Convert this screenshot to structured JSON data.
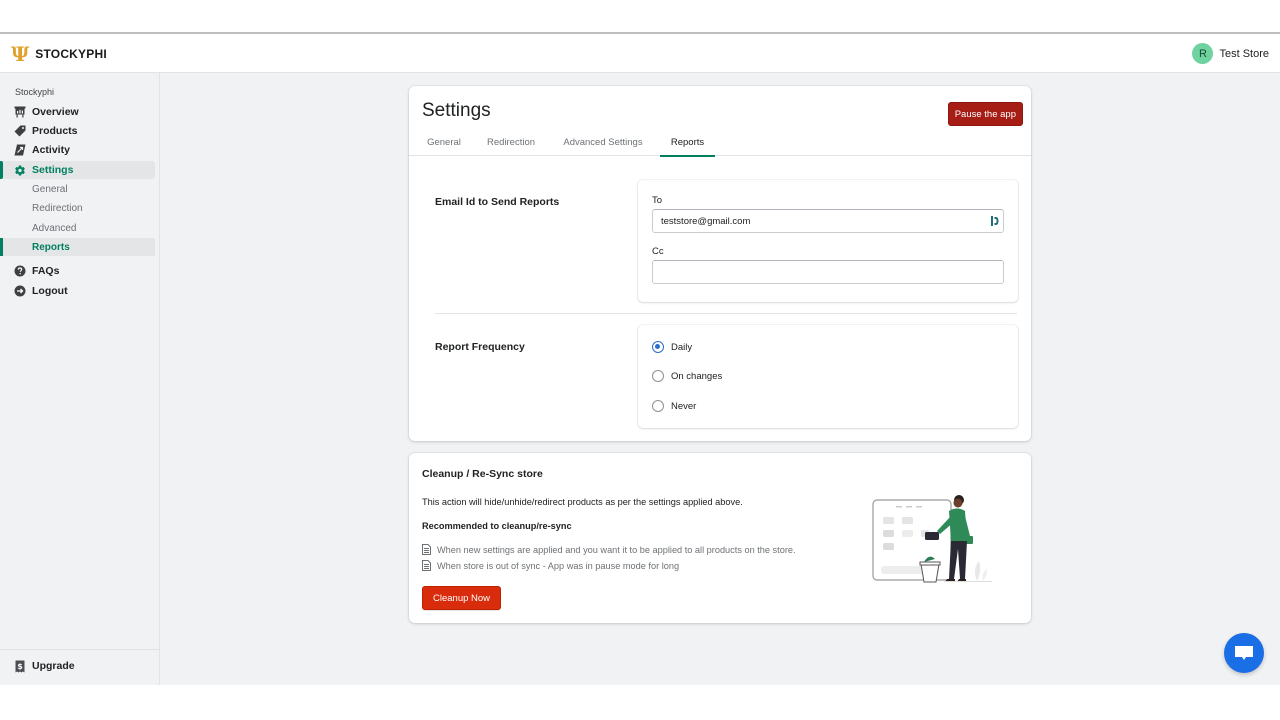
{
  "app": {
    "brand": "STOCKYPHI",
    "brand_mark": "Ψ",
    "accent_color": "#008060",
    "danger_color": "#a51d15"
  },
  "user": {
    "avatar_initial": "R",
    "store_name": "Test Store"
  },
  "sidebar": {
    "section_title": "Stockyphi",
    "items": [
      {
        "label": "Overview",
        "icon": "chart-board-icon"
      },
      {
        "label": "Products",
        "icon": "tag-icon"
      },
      {
        "label": "Activity",
        "icon": "activity-icon"
      },
      {
        "label": "Settings",
        "icon": "gear-icon",
        "active": true
      },
      {
        "label": "FAQs",
        "icon": "question-circle-icon"
      },
      {
        "label": "Logout",
        "icon": "logout-icon"
      }
    ],
    "sub_items": [
      {
        "label": "General"
      },
      {
        "label": "Redirection"
      },
      {
        "label": "Advanced"
      },
      {
        "label": "Reports",
        "active": true
      }
    ],
    "bottom_item": {
      "label": "Upgrade",
      "icon": "dollar-receipt-icon"
    }
  },
  "settings": {
    "title": "Settings",
    "pause_button": "Pause the app",
    "tabs": [
      {
        "label": "General"
      },
      {
        "label": "Redirection"
      },
      {
        "label": "Advanced Settings"
      },
      {
        "label": "Reports",
        "active": true
      }
    ],
    "email_section": {
      "label": "Email Id to Send Reports",
      "to_label": "To",
      "to_value": "teststore@gmail.com",
      "cc_label": "Cc",
      "cc_value": ""
    },
    "frequency_section": {
      "label": "Report Frequency",
      "options": [
        {
          "label": "Daily",
          "checked": true
        },
        {
          "label": "On changes",
          "checked": false
        },
        {
          "label": "Never",
          "checked": false
        }
      ]
    }
  },
  "cleanup": {
    "title": "Cleanup / Re-Sync store",
    "description": "This action will hide/unhide/redirect products as per the settings applied above.",
    "recommended_title": "Recommended to cleanup/re-sync",
    "list": [
      "When new settings are applied and you want it to be applied to all products on the store.",
      "When store is out of sync - App was in pause mode for long"
    ],
    "button": "Cleanup Now"
  },
  "chat_widget": {
    "icon": "chat-bubble-icon"
  }
}
